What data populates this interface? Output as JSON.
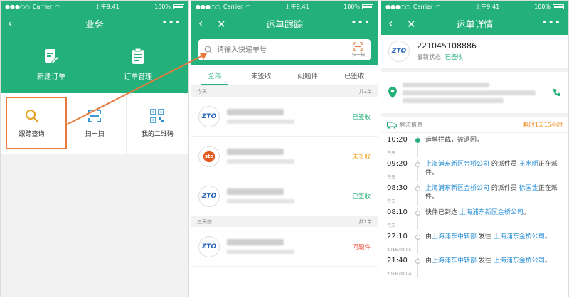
{
  "status": {
    "carrier": "Carrier",
    "time": "上午9:41",
    "battery": "100%"
  },
  "screen1": {
    "title": "业务",
    "more": "•••",
    "hero": [
      {
        "label": "新建订单",
        "icon": "edit-doc-icon"
      },
      {
        "label": "订单管理",
        "icon": "clipboard-icon"
      }
    ],
    "grid": [
      {
        "label": "跟踪查询",
        "icon": "search-icon"
      },
      {
        "label": "扫一扫",
        "icon": "scan-icon"
      },
      {
        "label": "我的二维码",
        "icon": "qrcode-icon"
      }
    ]
  },
  "screen2": {
    "title": "运单跟踪",
    "more": "•••",
    "search_placeholder": "请输入快递单号",
    "scan_label": "扫一扫",
    "tabs": [
      "全部",
      "未签收",
      "问题件",
      "已签收"
    ],
    "sections": [
      {
        "label": "今天",
        "count": "共3单"
      },
      {
        "label": "三天前",
        "count": "共1单"
      }
    ],
    "rows": [
      {
        "carrier": "ZTO",
        "status": "已签收",
        "kind": "ok"
      },
      {
        "carrier": "sto",
        "status": "未签收",
        "kind": "wait"
      },
      {
        "carrier": "ZTO",
        "status": "已签收",
        "kind": "ok"
      },
      {
        "carrier": "ZTO",
        "status": "问题件",
        "kind": "bad"
      }
    ]
  },
  "screen3": {
    "title": "运单详情",
    "more": "•••",
    "tracking_no": "221045108886",
    "state_label": "最新状态:",
    "state_value": "已签收",
    "log_title": "物流信息",
    "duration": "耗时1天15小时",
    "events": [
      {
        "time": "10:20",
        "day": "今天",
        "done": true,
        "parts": [
          {
            "t": "运单拦截，被退回。"
          }
        ]
      },
      {
        "time": "09:20",
        "day": "今天",
        "done": false,
        "parts": [
          {
            "t": "上海浦东新区金桥公司",
            "link": true
          },
          {
            "t": " 的派件员 "
          },
          {
            "t": "王水明",
            "link": true
          },
          {
            "t": "正在派件。"
          }
        ]
      },
      {
        "time": "08:30",
        "day": "今天",
        "done": false,
        "parts": [
          {
            "t": "上海浦东新区金桥公司",
            "link": true
          },
          {
            "t": " 的派件员 "
          },
          {
            "t": "徐国金",
            "link": true
          },
          {
            "t": "正在派件。"
          }
        ]
      },
      {
        "time": "08:10",
        "day": "今天",
        "done": false,
        "parts": [
          {
            "t": "快件已到达 "
          },
          {
            "t": "上海浦东新区金桥公司",
            "link": true
          },
          {
            "t": "。"
          }
        ]
      },
      {
        "time": "22:10",
        "day": "2016.08.05",
        "done": false,
        "parts": [
          {
            "t": "由"
          },
          {
            "t": "上海浦东中转部",
            "link": true
          },
          {
            "t": " 发往 "
          },
          {
            "t": "上海浦东金桥公司",
            "link": true
          },
          {
            "t": "。"
          }
        ]
      },
      {
        "time": "21:40",
        "day": "2016.08.04",
        "done": false,
        "parts": [
          {
            "t": "由"
          },
          {
            "t": "上海浦东中转部",
            "link": true
          },
          {
            "t": " 发往 "
          },
          {
            "t": "上海浦东金桥公司",
            "link": true
          },
          {
            "t": "。"
          }
        ]
      }
    ]
  },
  "colors": {
    "brand": "#24b07a",
    "highlight": "#e87a3e",
    "link": "#2a8fd6",
    "warn": "#f0a020",
    "error": "#e94a3a"
  }
}
